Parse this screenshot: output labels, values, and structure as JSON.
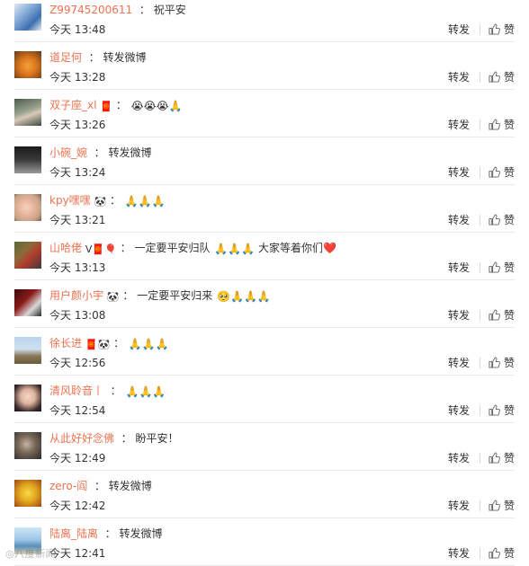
{
  "actions": {
    "repost": "转发",
    "like": "赞"
  },
  "watermark": "◎八度新闻",
  "comments": [
    {
      "user": "Z99745200611",
      "sep": "：",
      "text": "祝平安",
      "emojis": "",
      "badges": "",
      "time": "今天 13:48",
      "avatar": "stitch"
    },
    {
      "user": "道足何",
      "sep": "：",
      "text": "转发微博",
      "emojis": "",
      "badges": "",
      "time": "今天 13:28",
      "avatar": "garfield"
    },
    {
      "user": "双子座_xl",
      "sep": "：",
      "text": "",
      "emojis": "😭😭😭🙏",
      "badges": "🧧",
      "time": "今天 13:26",
      "avatar": "woman"
    },
    {
      "user": "小碗_婉",
      "sep": "：",
      "text": "转发微博",
      "emojis": "",
      "badges": "",
      "time": "今天 13:24",
      "avatar": "dark"
    },
    {
      "user": "kpy嘿嘿",
      "sep": "：",
      "text": "",
      "emojis": "🙏🙏🙏",
      "badges": "🐼",
      "time": "今天 13:21",
      "avatar": "child"
    },
    {
      "user": "山哈佬",
      "sep": "：",
      "text": "一定要平安归队",
      "emojis": "🙏🙏🙏",
      "tail": "大家等着你们❤️",
      "badges": "V🧧🎈",
      "time": "今天 13:13",
      "avatar": "crowd"
    },
    {
      "user": "用户颜小宇",
      "sep": "：",
      "text": "一定要平安归来",
      "emojis": "🥺🙏🙏🙏",
      "badges": "🐼",
      "time": "今天 13:08",
      "avatar": "red"
    },
    {
      "user": "徐长进",
      "sep": "：",
      "text": "",
      "emojis": "🙏🙏🙏",
      "badges": "🧧🐼",
      "time": "今天 12:56",
      "avatar": "landscape"
    },
    {
      "user": "清风聆音丨",
      "sep": "：",
      "text": "",
      "emojis": "🙏🙏🙏",
      "badges": "",
      "time": "今天 12:54",
      "avatar": "girl"
    },
    {
      "user": "从此好好念佛",
      "sep": "：",
      "text": "盼平安！",
      "emojis": "",
      "badges": "",
      "time": "今天 12:49",
      "avatar": "man"
    },
    {
      "user": "zero-阎",
      "sep": "：",
      "text": "转发微博",
      "emojis": "",
      "badges": "",
      "time": "今天 12:42",
      "avatar": "yellow"
    },
    {
      "user": "陆离_陆离",
      "sep": "：",
      "text": "转发微博",
      "emojis": "",
      "badges": "",
      "time": "今天 12:41",
      "avatar": "sea"
    }
  ]
}
